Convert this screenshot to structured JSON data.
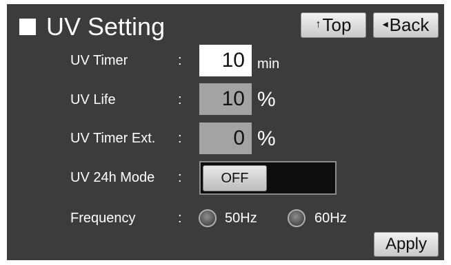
{
  "header": {
    "title": "UV Setting",
    "top_label": "Top",
    "back_label": "Back",
    "top_icon": "up-arrow",
    "back_icon": "left-triangle"
  },
  "fields": {
    "uv_timer": {
      "label": "UV Timer",
      "colon": ":",
      "value": "10",
      "unit": "min"
    },
    "uv_life": {
      "label": "UV Life",
      "colon": ":",
      "value": "10",
      "unit": "%"
    },
    "uv_timer_ext": {
      "label": "UV Timer Ext.",
      "colon": ":",
      "value": "0",
      "unit": "%"
    },
    "uv_24h_mode": {
      "label": "UV 24h Mode",
      "colon": ":",
      "state": "OFF"
    },
    "frequency": {
      "label": "Frequency",
      "colon": ":",
      "options": [
        "50Hz",
        "60Hz"
      ]
    }
  },
  "footer": {
    "apply_label": "Apply"
  },
  "colors": {
    "panel_bg": "#3c3c3c",
    "text": "#ffffff",
    "editable_value_bg": "#ffffff",
    "readonly_value_bg": "#a3a3a3",
    "toggle_track": "#0d0d0d"
  }
}
